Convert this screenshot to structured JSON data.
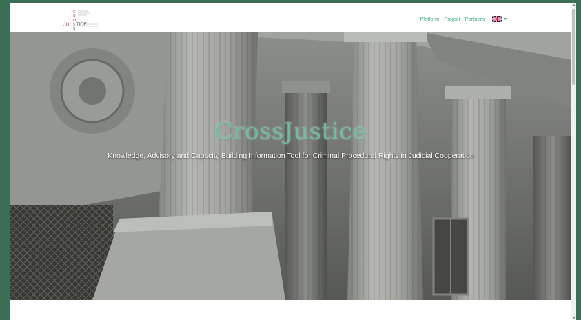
{
  "brand": {
    "logo_text": "JUSTICE",
    "logo_vertical_letters": [
      "C",
      "R",
      "O",
      "S",
      "S"
    ],
    "colors": {
      "accent": "#3fa88a",
      "logo_red": "#b4334d",
      "frame": "#3b6f55"
    }
  },
  "nav": {
    "items": [
      {
        "label": "Platform"
      },
      {
        "label": "Project"
      },
      {
        "label": "Partners"
      }
    ],
    "language_icon": "uk-flag-icon"
  },
  "hero": {
    "title": "CrossJustice",
    "subtitle": "Knowledge, Advisory and Capacity Building Information Tool for Criminal Procedural Rights in Judicial Cooperation"
  }
}
